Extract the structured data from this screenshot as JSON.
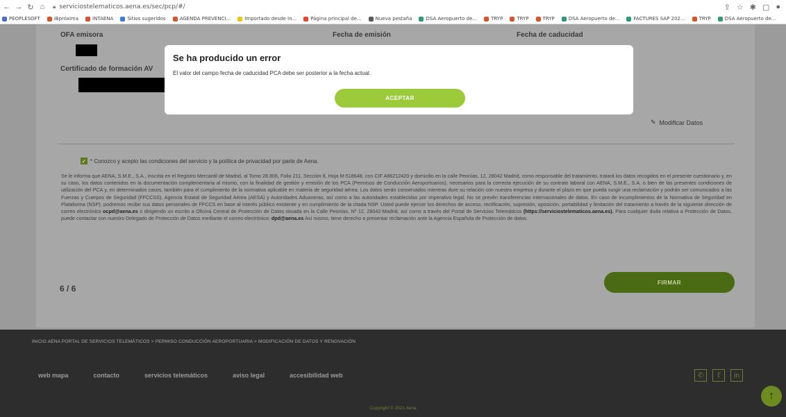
{
  "browser": {
    "url": "serviciostelematicos.aena.es/sec/pcp/#/",
    "bookmarks": [
      {
        "label": "PEOPLESOFT",
        "color": "#4a6bd1"
      },
      {
        "label": "iBpróxima",
        "color": "#d9532b"
      },
      {
        "label": "INTAENA",
        "color": "#d9532b"
      },
      {
        "label": "Sitios sugeridos",
        "color": "#3b7dd8"
      },
      {
        "label": "AGENDA PREVENCI...",
        "color": "#d9532b"
      },
      {
        "label": "Importado desde In...",
        "color": "#f0c419"
      },
      {
        "label": "Página principal de...",
        "color": "#e8452f"
      },
      {
        "label": "Nueva pestaña",
        "color": "#5a5a5a"
      },
      {
        "label": "DSA Aeropuerto de...",
        "color": "#2e9a7a"
      },
      {
        "label": "TRYP",
        "color": "#d9532b"
      },
      {
        "label": "TRYP",
        "color": "#d9532b"
      },
      {
        "label": "TRYP",
        "color": "#d9532b"
      },
      {
        "label": "DSA Aeropuerto de...",
        "color": "#2e9a7a"
      },
      {
        "label": "FACTURES SAP 202...",
        "color": "#2e9a7a"
      },
      {
        "label": "TRYP",
        "color": "#d9532b"
      },
      {
        "label": "DSA Aeropuerto de...",
        "color": "#2e9a7a"
      }
    ]
  },
  "form": {
    "label_oea": "OFA emisora",
    "label_issue": "Fecha de emisión",
    "label_expiry": "Fecha de caducidad",
    "label_cert": "Certificado de formación AV",
    "modify_label": "Modificar Datos",
    "consent_label": "* Conozco y acepto las condiciones del servicio y la política de privacidad por parte de Aena.",
    "legal_part1": "Se le informa que AENA, S.M.E., S.A., inscrita en el Registro Mercantil de Madrid, al Tomo 28.806, Folio 211, Sección 8, Hoja M-518648, con CIF A86212420 y domicilio en la calle Peonías, 12, 28042 Madrid, como responsable del tratamiento, tratará los datos recogidos en el presente cuestionario y, en su caso, los datos contenidos en la documentación complementaria al mismo, con la finalidad de gestión y emisión de los PCA (Permisos de Conducción Aeroportuarios), necesarios para la correcta ejecución de su contrato laboral con AENA, S.M.E., S.A. o bien de las presentes condiciones de utilización del PCA y, en determinados casos, también para el cumplimiento de la normativa aplicable en materia de seguridad aérea. Los datos serán conservados mientras dure su relación con nuestra empresa y durante el plazo en que pueda surgir una reclamación y podrán ser comunicados a las Fuerzas y Cuerpos de Seguridad (FFCCSS), Agencia Estatal de Seguridad Aérea (AESA) y Autoridades Aduaneras, así como a las autoridades establecidas por imperativo legal. No se prevén transferencias internacionales de datos. En caso de incumplimientos de la Normativa de Seguridad en Plataforma (NSP), podremos recibir sus datos personales de FFCCS en base al interés público existente y en cumplimiento de la citada NSP. Usted puede ejercer los derechos de acceso, rectificación, supresión, oposición, portabilidad y limitación del tratamiento a través de la siguiente dirección de correo electrónico ",
    "legal_email1": "ocpd@aena.es",
    "legal_part2": " o dirigiendo un escrito a Oficina Central de Protección de Datos situada en la Calle Peonías, Nº 12, 28042-Madrid, así como a través del Portal de Servicios Telemáticos ",
    "legal_url": "(https://serviciostelematicos.aena.es).",
    "legal_part3": " Para cualquier duda relativa a Protección de Datos, puede contactar con nuestro Delegado de Protección de Datos mediante el correo electrónico: ",
    "legal_email2": "dpd@aena.es",
    "legal_part4": " Así mismo, tiene derecho a presentar reclamación ante la Agencia Española de Protección de datos.",
    "steps": "6 / 6",
    "sign_label": "FIRMAR"
  },
  "footer": {
    "breadcrumb": "INICIO AENA PORTAL DE SERVICIOS TELEMÁTICOS  >  PERMISO CONDUCCIÓN AEROPORTUARIA  >  MODIFICACIÓN DE DATOS Y RENOVACIÓN",
    "links": [
      "web mapa",
      "contacto",
      "servicios telemáticos",
      "aviso legal",
      "accesibilidad web"
    ],
    "copyright": "Copyright © 2021 Aena"
  },
  "modal": {
    "title": "Se ha producido un error",
    "message": "El valor del campo fecha de caducidad PCA debe ser posterior a la fecha actual.",
    "accept_label": "ACEPTAR"
  }
}
